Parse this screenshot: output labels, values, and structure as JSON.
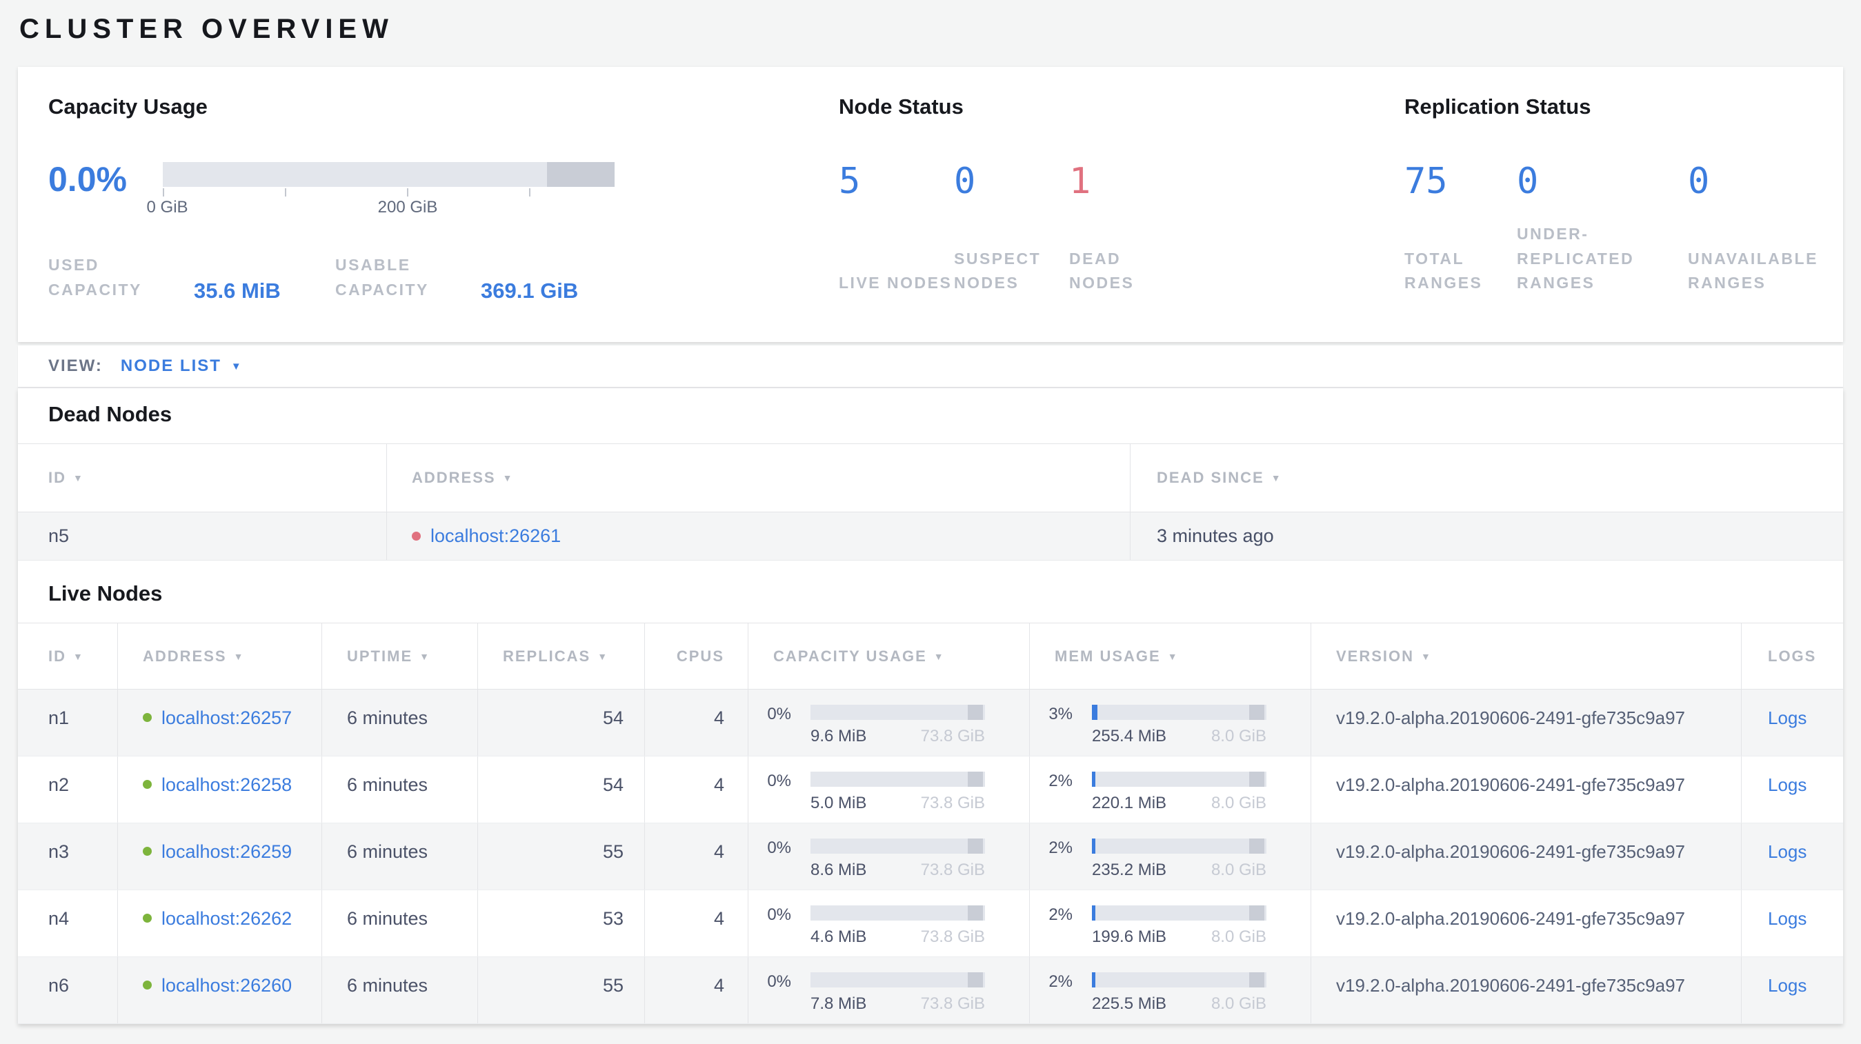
{
  "colors": {
    "accent_blue": "#3b7cde",
    "danger_red": "#e0717f",
    "live_green": "#7db43c",
    "bar_track": "#e3e6ec",
    "bar_reserved": "#c9cdd6"
  },
  "icons": {
    "sort": "▼",
    "caret": "▼"
  },
  "page": {
    "title": "CLUSTER OVERVIEW"
  },
  "summary": {
    "capacity": {
      "title": "Capacity Usage",
      "percent": "0.0%",
      "used_pct_of_bar": 0,
      "tick_labels": [
        "0 GiB",
        "200 GiB"
      ],
      "used_label": "USED CAPACITY",
      "used_value": "35.6 MiB",
      "usable_label": "USABLE CAPACITY",
      "usable_value": "369.1 GiB"
    },
    "node_status": {
      "title": "Node Status",
      "stats": [
        {
          "value": "5",
          "label": "LIVE NODES"
        },
        {
          "value": "0",
          "label": "SUSPECT NODES"
        },
        {
          "value": "1",
          "label": "DEAD NODES"
        }
      ]
    },
    "replication": {
      "title": "Replication Status",
      "stats": [
        {
          "value": "75",
          "label": "TOTAL RANGES"
        },
        {
          "value": "0",
          "label": "UNDER-REPLICATED RANGES"
        },
        {
          "value": "0",
          "label": "UNAVAILABLE RANGES"
        }
      ]
    }
  },
  "view_bar": {
    "label": "VIEW:",
    "selected": "NODE LIST"
  },
  "dead_nodes": {
    "title": "Dead Nodes",
    "columns": [
      "ID",
      "ADDRESS",
      "DEAD SINCE"
    ],
    "rows": [
      {
        "id": "n5",
        "address": "localhost:26261",
        "dead_since": "3 minutes ago"
      }
    ]
  },
  "live_nodes": {
    "title": "Live Nodes",
    "columns": [
      "ID",
      "ADDRESS",
      "UPTIME",
      "REPLICAS",
      "CPUS",
      "CAPACITY USAGE",
      "MEM USAGE",
      "VERSION",
      "LOGS"
    ],
    "rows": [
      {
        "id": "n1",
        "address": "localhost:26257",
        "uptime": "6 minutes",
        "replicas": "54",
        "cpus": "4",
        "capacity": {
          "percent": "0%",
          "percent_num": 0,
          "used": "9.6 MiB",
          "total": "73.8 GiB"
        },
        "memory": {
          "percent": "3%",
          "percent_num": 3,
          "used": "255.4 MiB",
          "total": "8.0 GiB"
        },
        "version": "v19.2.0-alpha.20190606-2491-gfe735c9a97",
        "logs_label": "Logs"
      },
      {
        "id": "n2",
        "address": "localhost:26258",
        "uptime": "6 minutes",
        "replicas": "54",
        "cpus": "4",
        "capacity": {
          "percent": "0%",
          "percent_num": 0,
          "used": "5.0 MiB",
          "total": "73.8 GiB"
        },
        "memory": {
          "percent": "2%",
          "percent_num": 2,
          "used": "220.1 MiB",
          "total": "8.0 GiB"
        },
        "version": "v19.2.0-alpha.20190606-2491-gfe735c9a97",
        "logs_label": "Logs"
      },
      {
        "id": "n3",
        "address": "localhost:26259",
        "uptime": "6 minutes",
        "replicas": "55",
        "cpus": "4",
        "capacity": {
          "percent": "0%",
          "percent_num": 0,
          "used": "8.6 MiB",
          "total": "73.8 GiB"
        },
        "memory": {
          "percent": "2%",
          "percent_num": 2,
          "used": "235.2 MiB",
          "total": "8.0 GiB"
        },
        "version": "v19.2.0-alpha.20190606-2491-gfe735c9a97",
        "logs_label": "Logs"
      },
      {
        "id": "n4",
        "address": "localhost:26262",
        "uptime": "6 minutes",
        "replicas": "53",
        "cpus": "4",
        "capacity": {
          "percent": "0%",
          "percent_num": 0,
          "used": "4.6 MiB",
          "total": "73.8 GiB"
        },
        "memory": {
          "percent": "2%",
          "percent_num": 2,
          "used": "199.6 MiB",
          "total": "8.0 GiB"
        },
        "version": "v19.2.0-alpha.20190606-2491-gfe735c9a97",
        "logs_label": "Logs"
      },
      {
        "id": "n6",
        "address": "localhost:26260",
        "uptime": "6 minutes",
        "replicas": "55",
        "cpus": "4",
        "capacity": {
          "percent": "0%",
          "percent_num": 0,
          "used": "7.8 MiB",
          "total": "73.8 GiB"
        },
        "memory": {
          "percent": "2%",
          "percent_num": 2,
          "used": "225.5 MiB",
          "total": "8.0 GiB"
        },
        "version": "v19.2.0-alpha.20190606-2491-gfe735c9a97",
        "logs_label": "Logs"
      }
    ]
  }
}
